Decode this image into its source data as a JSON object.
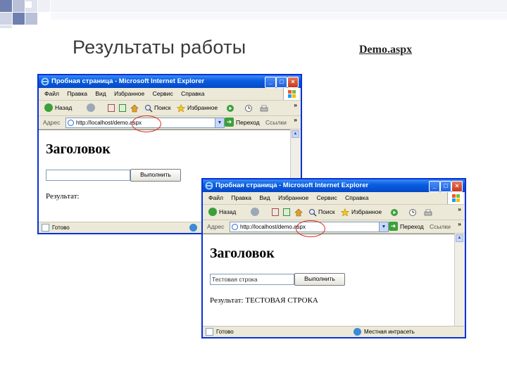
{
  "slide": {
    "title": "Результаты работы",
    "file": "Demo.aspx"
  },
  "browser_window": {
    "title": "Пробная страница - Microsoft Internet Explorer",
    "menu": [
      "Файл",
      "Правка",
      "Вид",
      "Избранное",
      "Сервис",
      "Справка"
    ],
    "toolbar": {
      "back": "Назад",
      "search": "Поиск",
      "favorites": "Избранное"
    },
    "address_label": "Адрес",
    "url": "http://localhost/demo.aspx",
    "go": "Переход",
    "links": "Ссылки",
    "overflow": "»"
  },
  "before": {
    "heading": "Заголовок",
    "input_value": "",
    "button": "Выполнить",
    "result": "Результат:",
    "status": "Готово",
    "status_zone": ""
  },
  "after": {
    "heading": "Заголовок",
    "input_value": "Тестовая строка",
    "button": "Выполнить",
    "result": "Результат: ТЕСТОВАЯ СТРОКА",
    "status": "Готово",
    "status_zone": "Местная интрасеть"
  },
  "colors": {
    "titlebar": "#0a5fe0",
    "highlight_ellipse": "#e02b1c",
    "deco_squares": "#6b7fb8"
  }
}
